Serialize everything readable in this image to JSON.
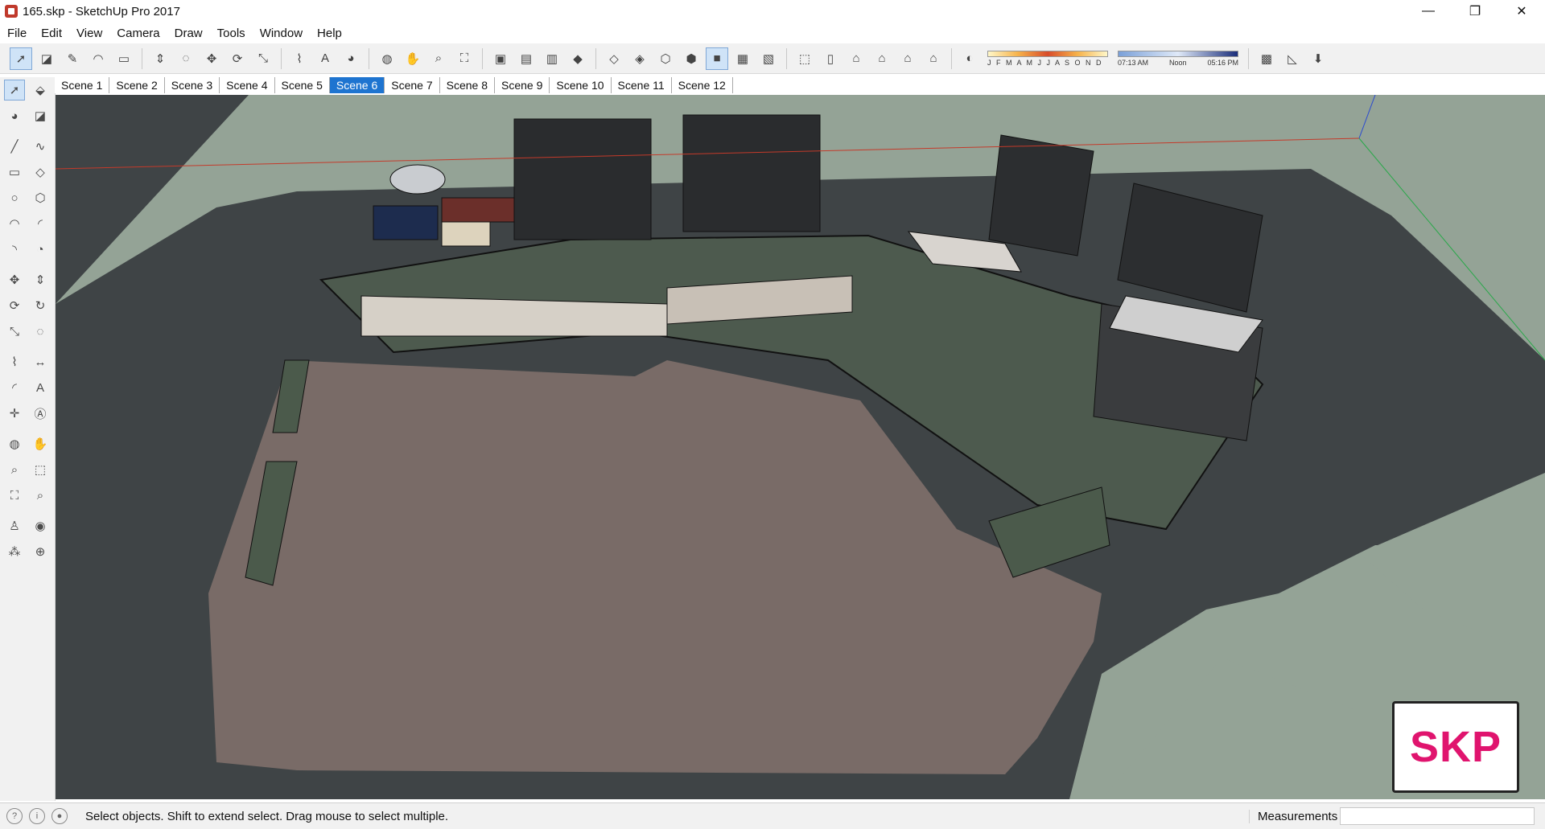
{
  "window": {
    "title": "165.skp - SketchUp Pro 2017",
    "minimize": "—",
    "maximize": "❐",
    "close": "✕"
  },
  "menu": [
    "File",
    "Edit",
    "View",
    "Camera",
    "Draw",
    "Tools",
    "Window",
    "Help"
  ],
  "toolbar": {
    "months": "J F M A M J J A S O N D",
    "time_start": "07:13 AM",
    "time_mid": "Noon",
    "time_end": "05:16 PM"
  },
  "scenes": {
    "tabs": [
      "Scene 1",
      "Scene 2",
      "Scene 3",
      "Scene 4",
      "Scene 5",
      "Scene 6",
      "Scene 7",
      "Scene 8",
      "Scene 9",
      "Scene 10",
      "Scene 11",
      "Scene 12"
    ],
    "active": "Scene 6"
  },
  "badge": {
    "text": "SKP",
    "color": "#e0146e"
  },
  "status": {
    "hint": "Select objects. Shift to extend select. Drag mouse to select multiple.",
    "measurements_label": "Measurements",
    "measurements_value": ""
  },
  "colors": {
    "viewport_bg": "#94a396",
    "active_tab": "#1e74d0"
  }
}
